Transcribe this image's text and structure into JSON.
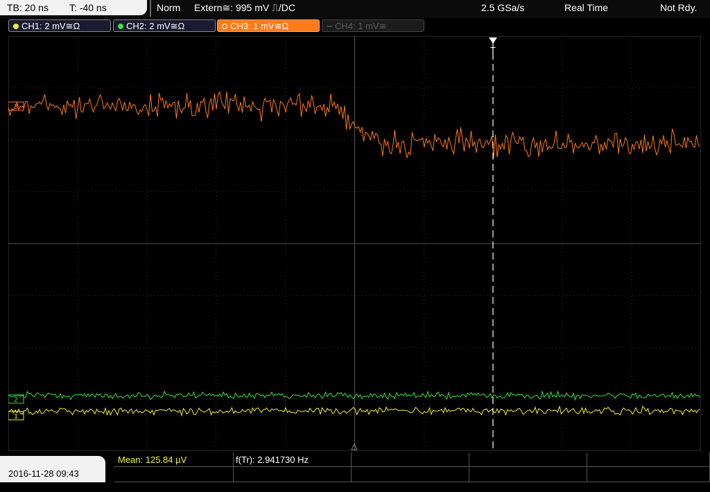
{
  "header": {
    "timebase": "TB: 20 ns",
    "trigger_time": "T: -40 ns",
    "mode": "Norm",
    "trigger_source": "Extern≅: 995 mV ⎍/DC",
    "sample_rate": "2.5 GSa/s",
    "acq_mode": "Real Time",
    "status": "Not Rdy."
  },
  "channels": [
    {
      "label": "CH1: 2 mV≅Ω",
      "color": "#f2f23a"
    },
    {
      "label": "CH2: 2 mV≅Ω",
      "color": "#3ce03c"
    },
    {
      "label": "CH3: 1 mV≅Ω",
      "color": "#ff7a1a"
    },
    {
      "label": "CH4: 1 mV≅",
      "color": "#5a5a5a"
    }
  ],
  "markers": {
    "trigger_marker": "T",
    "ch3_marker": "3",
    "ch2_marker": "2",
    "ch1_marker": "1"
  },
  "footer": {
    "datetime": "2016-11-28 09:43",
    "mean": "Mean: 125.84 µV",
    "frequency": "f(Tr): 2.941730 Hz"
  }
}
